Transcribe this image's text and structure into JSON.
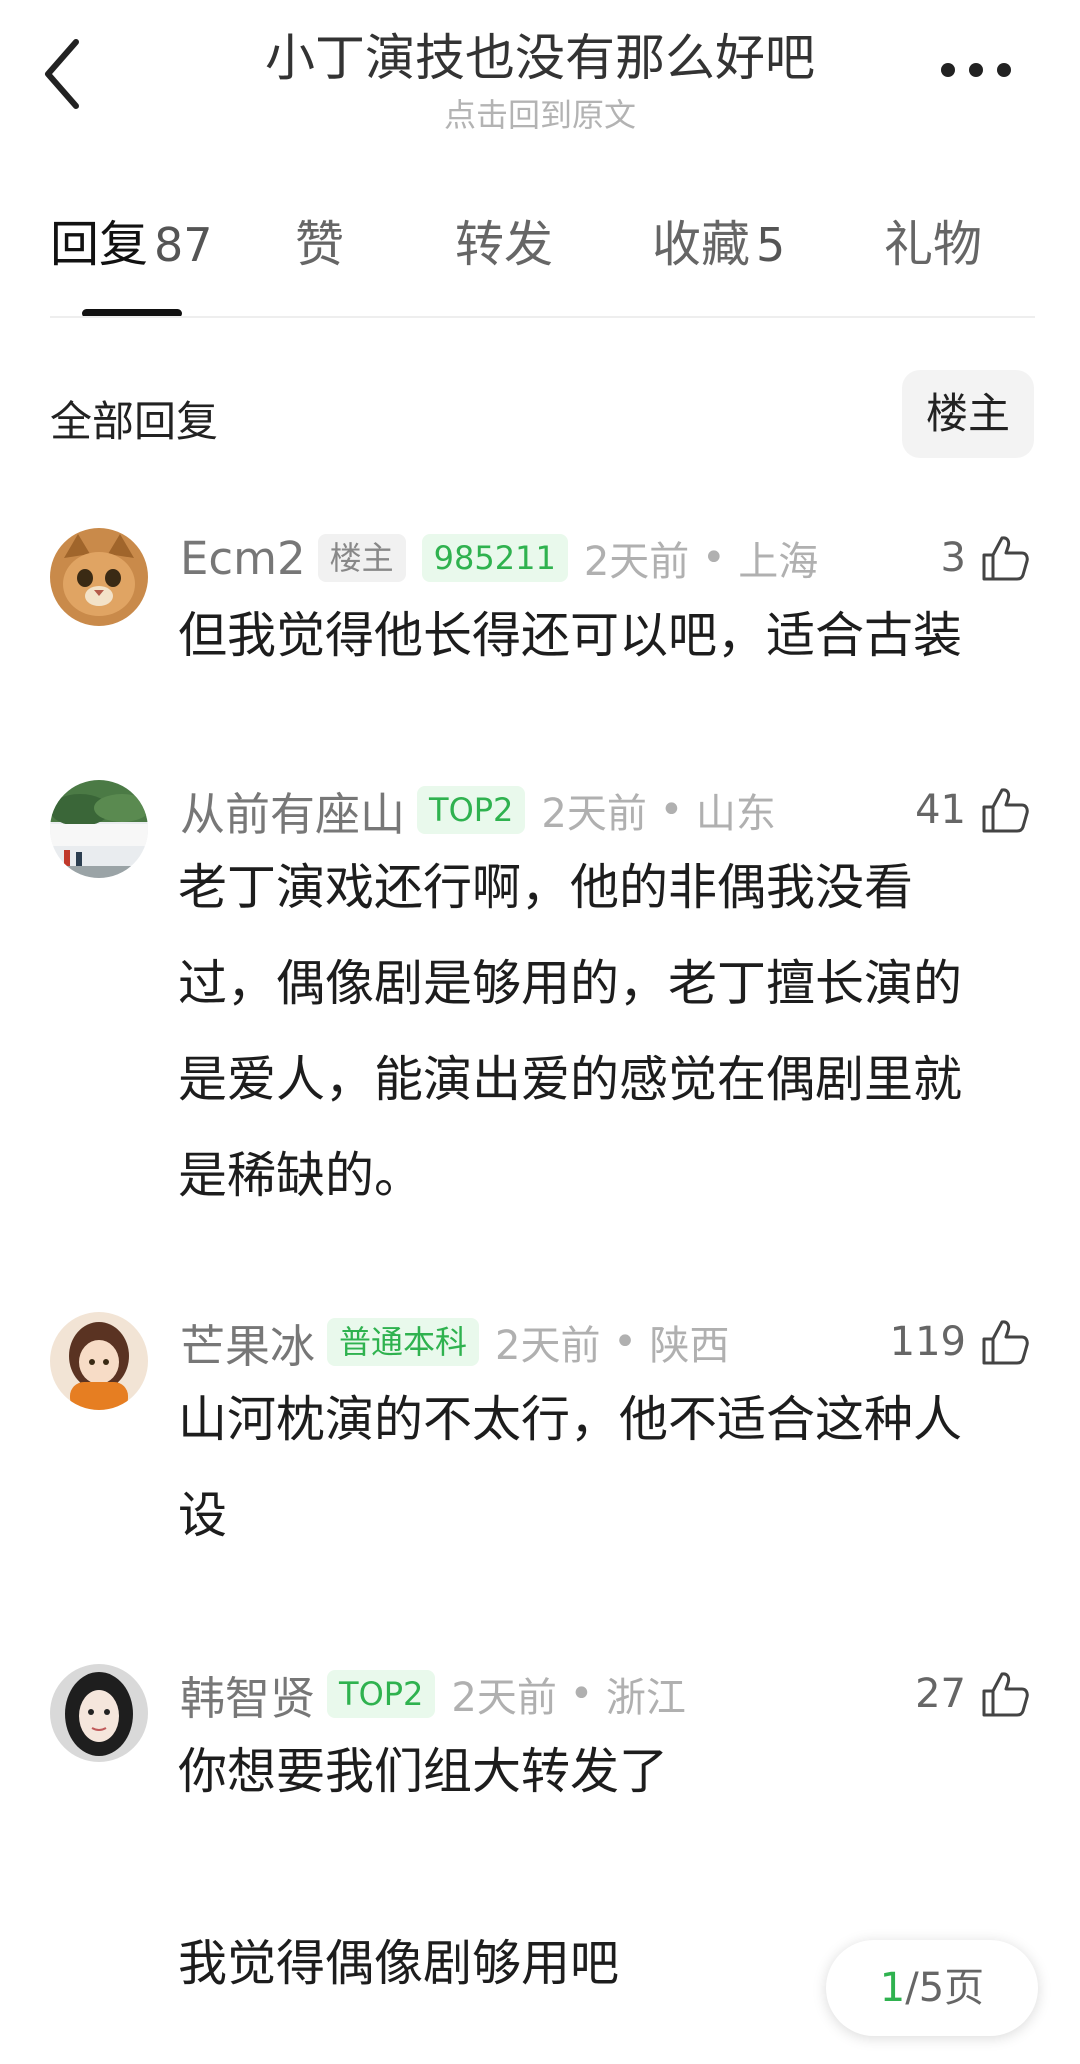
{
  "header": {
    "title": "小丁演技也没有那么好吧",
    "subtitle": "点击回到原文"
  },
  "tabs": [
    {
      "label": "回复",
      "count": "87",
      "active": true
    },
    {
      "label": "赞",
      "count": ""
    },
    {
      "label": "转发",
      "count": ""
    },
    {
      "label": "收藏",
      "count": "5"
    },
    {
      "label": "礼物",
      "count": ""
    }
  ],
  "filter": {
    "label": "全部回复",
    "button": "楼主"
  },
  "comments": [
    {
      "username": "Ecm2",
      "tags": [
        "楼主",
        "985211"
      ],
      "time": "2天前",
      "location": "上海",
      "likes": "3",
      "text": "但我觉得他长得还可以吧，适合古装"
    },
    {
      "username": "从前有座山",
      "tags": [
        "TOP2"
      ],
      "time": "2天前",
      "location": "山东",
      "likes": "41",
      "text": "老丁演戏还行啊，他的非偶我没看\n过，偶像剧是够用的，老丁擅长演的\n是爱人，能演出爱的感觉在偶剧里就\n是稀缺的。"
    },
    {
      "username": "芒果冰",
      "tags": [
        "普通本科"
      ],
      "time": "2天前",
      "location": "陕西",
      "likes": "119",
      "text": "山河枕演的不太行，他不适合这种人\n设"
    },
    {
      "username": "韩智贤",
      "tags": [
        "TOP2"
      ],
      "time": "2天前",
      "location": "浙江",
      "likes": "27",
      "text": "你想要我们组大转发了\n\n我觉得偶像剧够用吧"
    }
  ],
  "pager": {
    "current": "1",
    "total_text": "/5页"
  },
  "colors": {
    "accent_green": "#2fb24f",
    "tag_green_bg": "#e9f9ec",
    "muted": "#b0b0b0"
  }
}
